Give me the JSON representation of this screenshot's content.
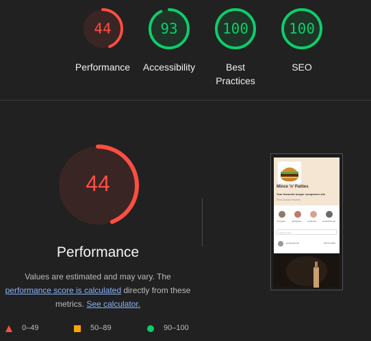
{
  "top_scores": [
    {
      "score": "44",
      "label": "Performance",
      "value": 44,
      "color": "#ff4e42",
      "bg": "#3a2525"
    },
    {
      "score": "93",
      "label": "Accessibility",
      "value": 93,
      "color": "#0cce6b",
      "bg": "#1f3326"
    },
    {
      "score": "100",
      "label": "Best Practices",
      "value": 100,
      "color": "#0cce6b",
      "bg": "#1f3326"
    },
    {
      "score": "100",
      "label": "SEO",
      "value": 100,
      "color": "#0cce6b",
      "bg": "#1f3326"
    }
  ],
  "main": {
    "score": "44",
    "value": 44,
    "title": "Performance",
    "desc_prefix": "Values are estimated and may vary. The",
    "desc_link": "performance score is calculated",
    "desc_mid": "directly from these metrics.",
    "desc_link2": "See calculator.",
    "color": "#ff4e42"
  },
  "legend": [
    {
      "range": "0–49",
      "color": "#ff4e42",
      "shape": "triangle"
    },
    {
      "range": "50–89",
      "color": "#ffa400",
      "shape": "square"
    },
    {
      "range": "90–100",
      "color": "#0cce6b",
      "shape": "circle"
    }
  ],
  "thumbnail": {
    "site_title": "Mince 'n' Patties",
    "tagline": "Your favourite burger companion site",
    "nav": "Feed   Contact   Recents",
    "users": [
      "coreyjack",
      "oliviagrace",
      "codeinpat",
      "wesleytheman"
    ],
    "search_placeholder": "Search posts",
    "post_user": "wesleytheman",
    "post_date": "29 Feb 2024"
  }
}
